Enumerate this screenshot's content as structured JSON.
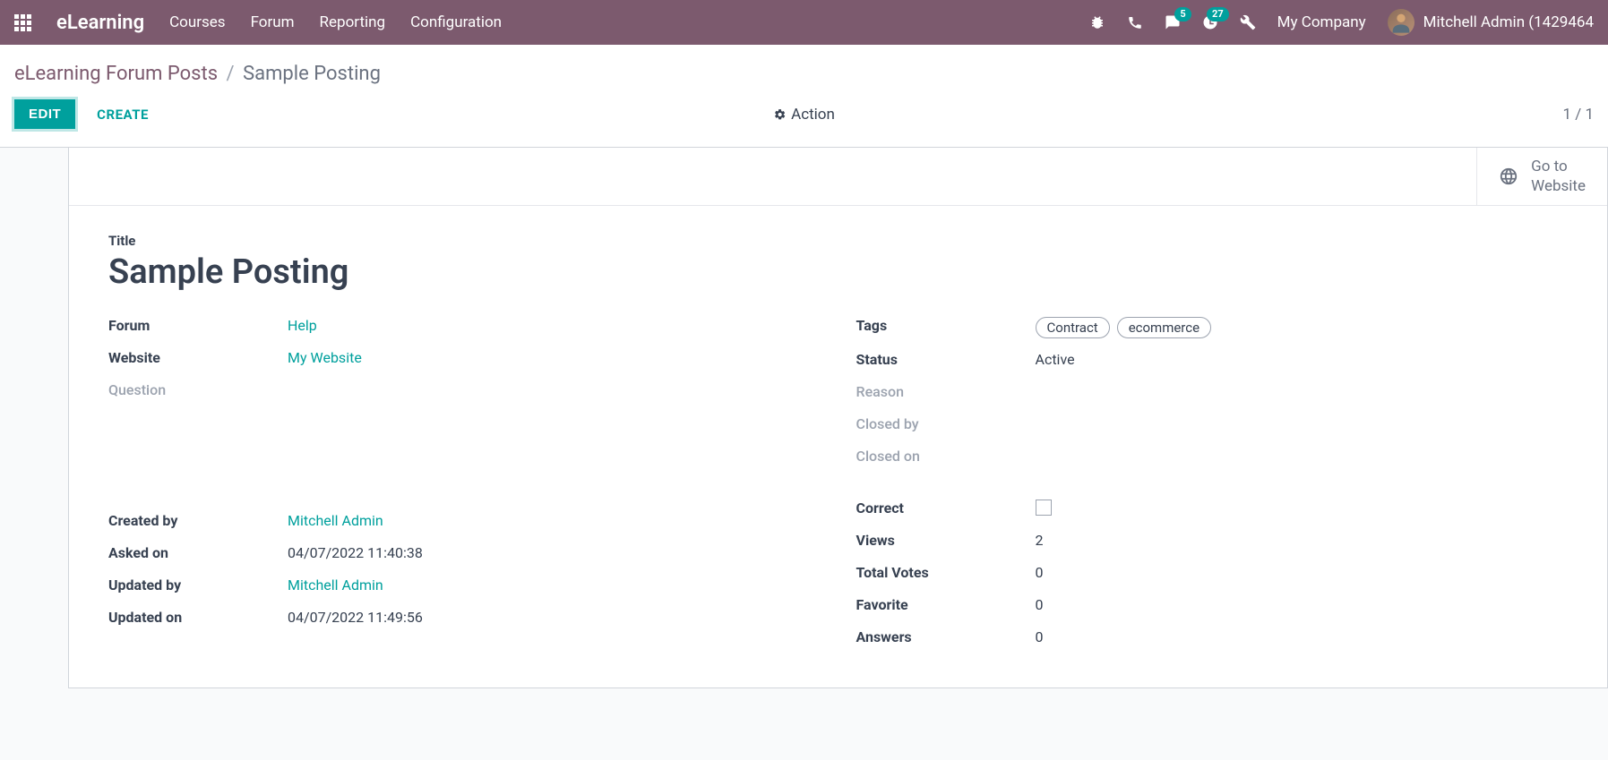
{
  "navbar": {
    "brand": "eLearning",
    "menu": [
      "Courses",
      "Forum",
      "Reporting",
      "Configuration"
    ],
    "messages_badge": "5",
    "activities_badge": "27",
    "company": "My Company",
    "user": "Mitchell Admin (1429464"
  },
  "breadcrumb": {
    "parent": "eLearning Forum Posts",
    "current": "Sample Posting"
  },
  "controls": {
    "edit": "EDIT",
    "create": "CREATE",
    "action": "Action",
    "pager": "1 / 1"
  },
  "goto": {
    "line1": "Go to",
    "line2": "Website"
  },
  "form": {
    "title_label": "Title",
    "title_value": "Sample Posting",
    "left": {
      "forum_label": "Forum",
      "forum_value": "Help",
      "website_label": "Website",
      "website_value": "My Website",
      "question_label": "Question",
      "created_by_label": "Created by",
      "created_by_value": "Mitchell Admin",
      "asked_on_label": "Asked on",
      "asked_on_value": "04/07/2022 11:40:38",
      "updated_by_label": "Updated by",
      "updated_by_value": "Mitchell Admin",
      "updated_on_label": "Updated on",
      "updated_on_value": "04/07/2022 11:49:56"
    },
    "right": {
      "tags_label": "Tags",
      "tags": [
        "Contract",
        "ecommerce"
      ],
      "status_label": "Status",
      "status_value": "Active",
      "reason_label": "Reason",
      "closed_by_label": "Closed by",
      "closed_on_label": "Closed on",
      "correct_label": "Correct",
      "views_label": "Views",
      "views_value": "2",
      "votes_label": "Total Votes",
      "votes_value": "0",
      "favorite_label": "Favorite",
      "favorite_value": "0",
      "answers_label": "Answers",
      "answers_value": "0"
    }
  }
}
